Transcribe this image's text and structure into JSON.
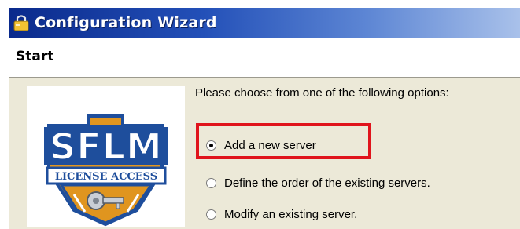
{
  "window": {
    "title": "Configuration Wizard",
    "icon": "wizard-app-icon"
  },
  "header": {
    "title": "Start"
  },
  "logo": {
    "brand": "SFLM",
    "subtitle": "LICENSE ACCESS",
    "colors": {
      "blue": "#1e4e9c",
      "orange": "#e0951f",
      "silver": "#c9ced6"
    }
  },
  "main": {
    "prompt": "Please choose from one of the following options:",
    "options": [
      {
        "label": "Add a new server",
        "selected": true
      },
      {
        "label": "Define the order of the existing servers.",
        "selected": false
      },
      {
        "label": "Modify an existing server.",
        "selected": false
      }
    ]
  },
  "annotation": {
    "color": "#e0141c"
  }
}
